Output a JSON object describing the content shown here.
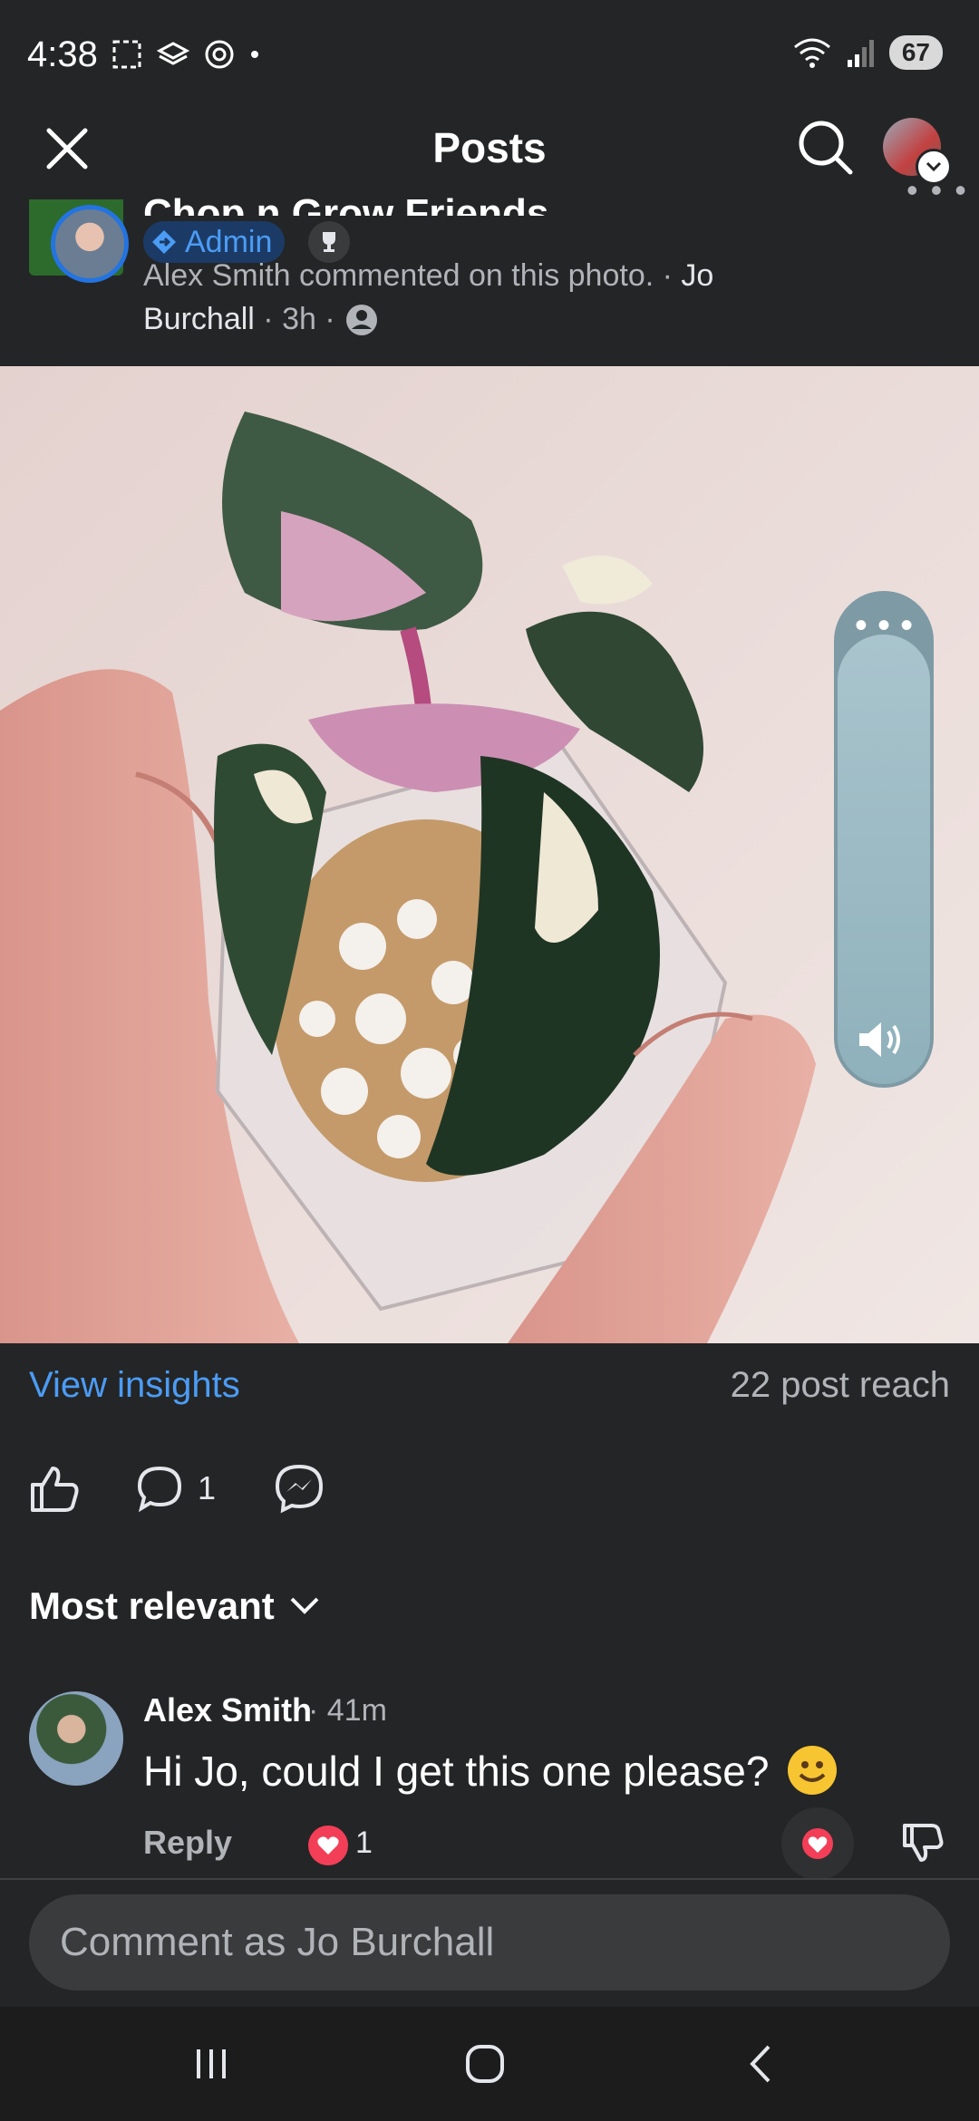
{
  "status_bar": {
    "time": "4:38",
    "network_label": "6",
    "battery": "67"
  },
  "header": {
    "title": "Posts"
  },
  "post": {
    "group_name": "Chop n Grow Friends",
    "admin_label": "Admin",
    "meta_text": "Alex Smith commented on this photo. · ",
    "author": "Jo Burchall",
    "time": "3h",
    "photo_icon": "plant-photo",
    "view_insights": "View insights",
    "post_reach": "22 post reach",
    "comment_count": "1"
  },
  "comments_section": {
    "sort_label": "Most relevant"
  },
  "comment": {
    "name": "Alex Smith",
    "time": "· 41m",
    "text": "Hi Jo, could I get this one please?",
    "reply_label": "Reply",
    "reaction_count": "1"
  },
  "composer": {
    "placeholder": "Comment as Jo Burchall"
  },
  "colors": {
    "background": "#242526",
    "accent_blue": "#4b9cf5",
    "heart": "#f33e58"
  }
}
